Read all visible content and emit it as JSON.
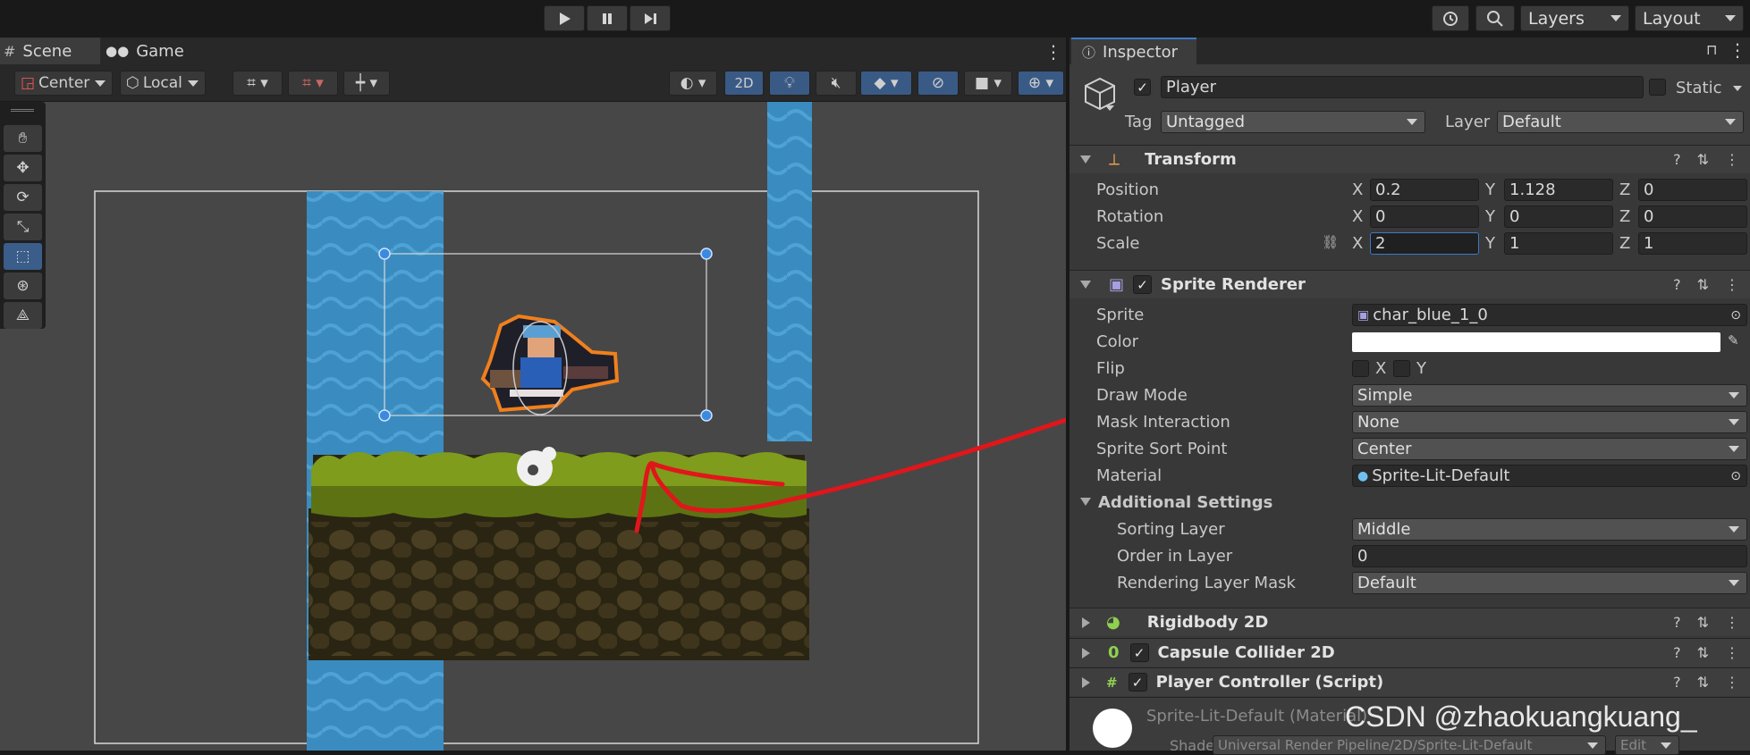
{
  "toolbar": {
    "play_icon": "play-icon",
    "pause_icon": "pause-icon",
    "step_icon": "step-icon",
    "layers_label": "Layers",
    "layout_label": "Layout"
  },
  "scene": {
    "tabs": [
      {
        "label": "Scene",
        "icon": "scene-grid-icon"
      },
      {
        "label": "Game",
        "icon": "gamepad-icon"
      }
    ],
    "pivot_mode": "Center",
    "pivot_rotation": "Local",
    "mode_2d": "2D"
  },
  "inspector": {
    "tab_label": "Inspector",
    "object_name": "Player",
    "static_label": "Static",
    "tag_label": "Tag",
    "tag_value": "Untagged",
    "layer_label": "Layer",
    "layer_value": "Default",
    "transform": {
      "title": "Transform",
      "position_label": "Position",
      "rotation_label": "Rotation",
      "scale_label": "Scale",
      "axis_x": "X",
      "axis_y": "Y",
      "axis_z": "Z",
      "position": {
        "x": "0.2",
        "y": "1.128",
        "z": "0"
      },
      "rotation": {
        "x": "0",
        "y": "0",
        "z": "0"
      },
      "scale": {
        "x": "2",
        "y": "1",
        "z": "1"
      }
    },
    "sprite_renderer": {
      "title": "Sprite Renderer",
      "sprite_label": "Sprite",
      "sprite_value": "char_blue_1_0",
      "color_label": "Color",
      "color_value": "#ffffff",
      "flip_label": "Flip",
      "flip_x": "X",
      "flip_y": "Y",
      "draw_mode_label": "Draw Mode",
      "draw_mode_value": "Simple",
      "mask_label": "Mask Interaction",
      "mask_value": "None",
      "sort_point_label": "Sprite Sort Point",
      "sort_point_value": "Center",
      "material_label": "Material",
      "material_value": "Sprite-Lit-Default",
      "additional_label": "Additional Settings",
      "sorting_layer_label": "Sorting Layer",
      "sorting_layer_value": "Middle",
      "order_label": "Order in Layer",
      "order_value": "0",
      "rendering_mask_label": "Rendering Layer Mask",
      "rendering_mask_value": "Default"
    },
    "components": [
      {
        "title": "Rigidbody 2D",
        "icon": "rigidbody-icon"
      },
      {
        "title": "Capsule Collider 2D",
        "icon": "capsule-collider-icon"
      },
      {
        "title": "Player Controller (Script)",
        "icon": "script-icon"
      }
    ],
    "material_preview": {
      "name": "Sprite-Lit-Default (Material)",
      "shader_label": "Shader",
      "shader_value": "Universal Render Pipeline/2D/Sprite-Lit-Default",
      "edit_label": "Edit"
    }
  },
  "watermark": "CSDN @zhaokuangkuang_",
  "colors": {
    "annotation": "#e0161b",
    "selection_outline": "#f0801c",
    "water": "#3a8cc0",
    "grass": "#7f9c1c",
    "dirt": "#2a2512"
  }
}
